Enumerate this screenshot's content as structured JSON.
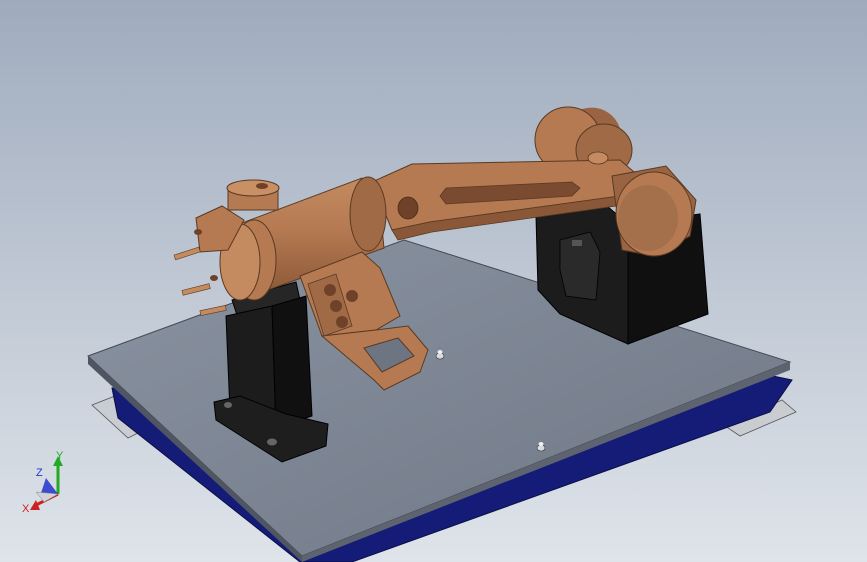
{
  "viewport": {
    "background_top": "#9fabbd",
    "background_bottom": "#dfe4ea"
  },
  "colors": {
    "part_bronze": "#b57a52",
    "part_bronze_dark": "#8a5838",
    "part_bronze_light": "#c98f65",
    "bracket_black": "#1a1a1a",
    "plate_top": "#7d8593",
    "plate_edge": "#5d6470",
    "base_blue": "#141c78",
    "axis_x": "#cc2222",
    "axis_y": "#22aa22",
    "axis_z": "#2233cc"
  },
  "triad": {
    "x_label": "X",
    "y_label": "Y",
    "z_label": "Z",
    "icon": "coordinate-triad-icon"
  }
}
